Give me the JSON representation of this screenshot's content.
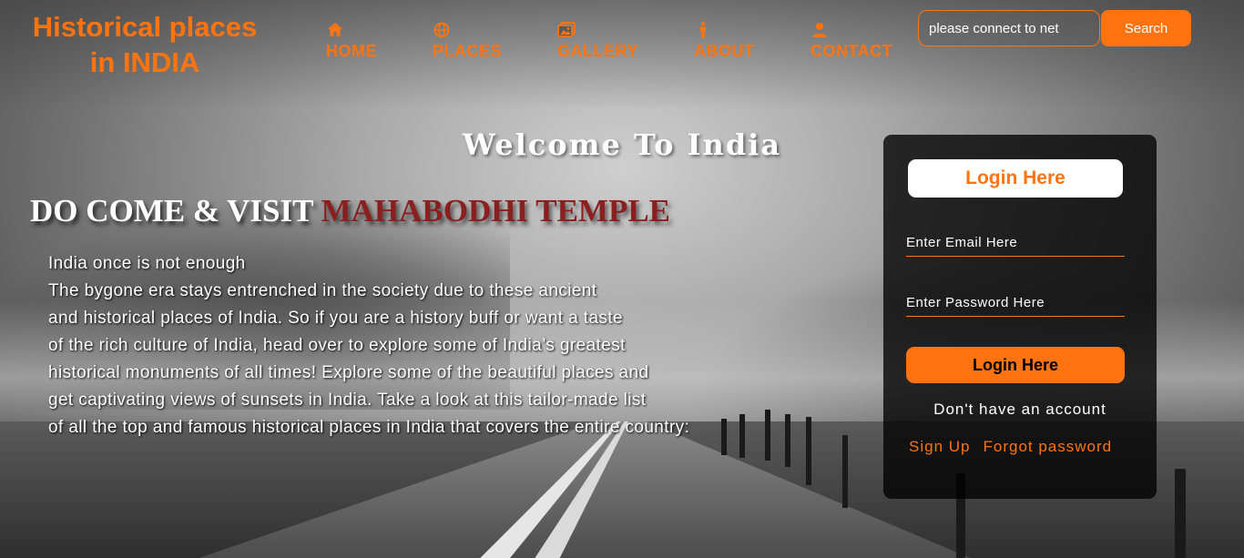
{
  "header": {
    "brand_line1": "Historical places",
    "brand_line2": "in INDIA",
    "nav": [
      {
        "label": "HOME",
        "icon": "home-icon"
      },
      {
        "label": "PLACES",
        "icon": "globe-icon"
      },
      {
        "label": "GALLERY",
        "icon": "image-icon"
      },
      {
        "label": "ABOUT",
        "icon": "person-icon"
      },
      {
        "label": "CONTACT",
        "icon": "user-icon"
      }
    ],
    "search": {
      "placeholder": "please connect to net",
      "button_label": "Search"
    }
  },
  "main": {
    "welcome": "Welcome To India",
    "headline_prefix": "DO COME & VISIT ",
    "headline_highlight": "MAHABODHI TEMPLE",
    "intro_lines": [
      "India once is not enough",
      "The bygone era stays entrenched in the society due to these ancient",
      "and historical places of India. So if you are a history buff or want a taste",
      "of the rich culture of India, head over to explore some of India’s greatest",
      "historical monuments of all times! Explore some of the beautiful places and",
      "get captivating views of sunsets in India. Take a look at this tailor-made list",
      "of all the top and famous historical places in India that covers the entire country:"
    ]
  },
  "login": {
    "title": "Login Here",
    "email_placeholder": "Enter Email Here",
    "password_placeholder": "Enter Password Here",
    "button_label": "Login Here",
    "no_account_text": "Don't have an account",
    "signup_link": "Sign Up",
    "forgot_link": "Forgot password"
  },
  "colors": {
    "accent": "#ff7410",
    "headline_highlight": "#8b1e1e",
    "panel": "#000000"
  }
}
